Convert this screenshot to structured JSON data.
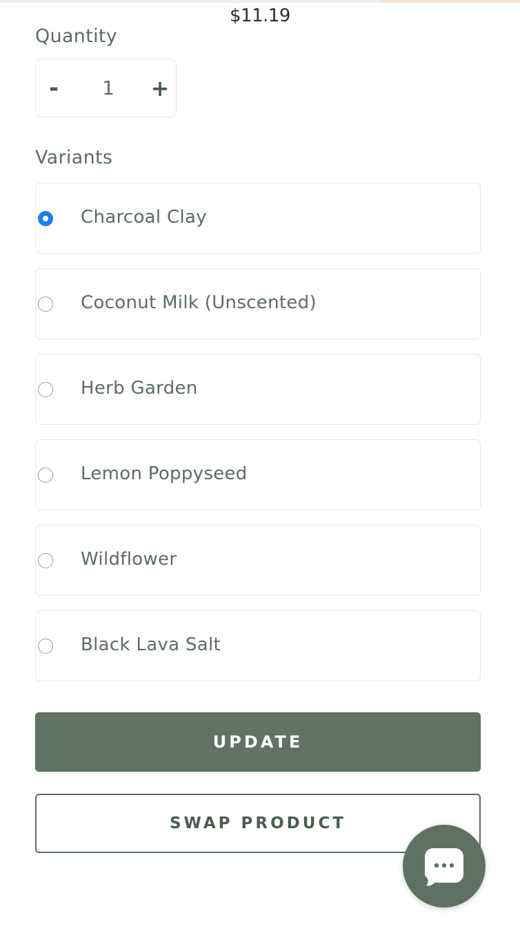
{
  "price": "$11.19",
  "quantity": {
    "label": "Quantity",
    "minus_symbol": "-",
    "value": "1",
    "plus_symbol": "+"
  },
  "variants": {
    "label": "Variants",
    "selected_index": 0,
    "options": [
      {
        "label": "Charcoal Clay"
      },
      {
        "label": "Coconut Milk (Unscented)"
      },
      {
        "label": "Herb Garden"
      },
      {
        "label": "Lemon Poppyseed"
      },
      {
        "label": "Wildflower"
      },
      {
        "label": "Black Lava Salt"
      }
    ]
  },
  "buttons": {
    "update": "UPDATE",
    "swap": "SWAP PRODUCT"
  },
  "chat": {
    "icon": "chat-bubble-icon"
  },
  "colors": {
    "brand_green": "#617463",
    "radio_selected": "#1a7ef2",
    "text": "#5b6e5f"
  }
}
